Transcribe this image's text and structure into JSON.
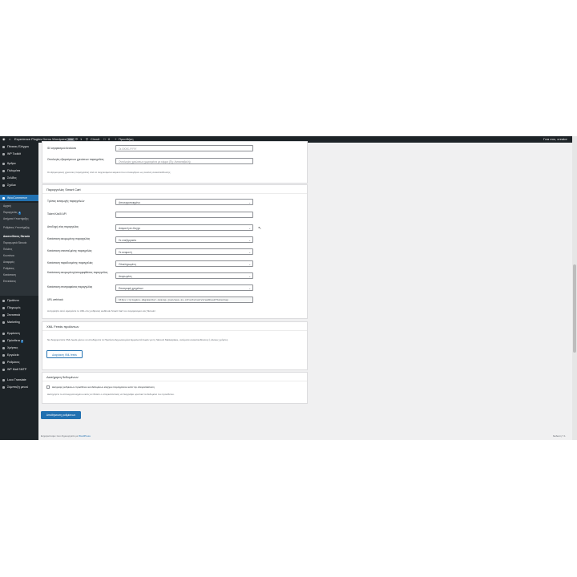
{
  "adminbar": {
    "site_name": "Experience Plugins Demo Wordpress",
    "new_badge": "new",
    "updates": "1",
    "search": "Circuit",
    "comments": "0",
    "add_new": "Προσθήκη",
    "howdy": "Γεια σου, creator"
  },
  "sidebar": {
    "items_top": [
      {
        "label": "Πίνακας Ελέγχου",
        "icon": "dashboard-icon"
      },
      {
        "label": "WP Toolkit",
        "icon": "toolkit-icon"
      },
      {
        "label": "Άρθρα",
        "icon": "pin-icon"
      },
      {
        "label": "Πολυμέσα",
        "icon": "media-icon"
      },
      {
        "label": "Σελίδες",
        "icon": "pages-icon"
      },
      {
        "label": "Σχόλια",
        "icon": "comments-icon"
      }
    ],
    "woocommerce": "WooCommerce",
    "submenu": [
      {
        "label": "Αρχική",
        "badge": ""
      },
      {
        "label": "Παραγγελίες",
        "badge": "1"
      },
      {
        "label": "Αιτήματα Υποστήριξης",
        "badge": ""
      },
      {
        "label": "Ρυθμίσεις Υποστήριξης",
        "badge": ""
      },
      {
        "label": "Διασυνδέσεις Skroutz",
        "badge": ""
      },
      {
        "label": "Παραγωγικά Skroutz",
        "badge": ""
      },
      {
        "label": "Πελάτες",
        "badge": ""
      },
      {
        "label": "Κουπόνια",
        "badge": ""
      },
      {
        "label": "Αναφορές",
        "badge": ""
      },
      {
        "label": "Ρυθμίσεις",
        "badge": ""
      },
      {
        "label": "Κατάσταση",
        "badge": ""
      },
      {
        "label": "Επεκτάσεις",
        "badge": ""
      }
    ],
    "items_bottom": [
      {
        "label": "Προϊόντα",
        "icon": "products-icon",
        "badge": ""
      },
      {
        "label": "Πληρωμές",
        "icon": "payments-icon",
        "badge": ""
      },
      {
        "label": "Στατιστικά",
        "icon": "stats-icon",
        "badge": ""
      },
      {
        "label": "Marketing",
        "icon": "marketing-icon",
        "badge": ""
      },
      {
        "label": "Εμφάνιση",
        "icon": "appearance-icon",
        "badge": ""
      },
      {
        "label": "Πρόσθετα",
        "icon": "plugins-icon",
        "badge": "3"
      },
      {
        "label": "Χρήστες",
        "icon": "users-icon",
        "badge": ""
      },
      {
        "label": "Εργαλεία",
        "icon": "tools-icon",
        "badge": ""
      },
      {
        "label": "Ρυθμίσεις",
        "icon": "settings-icon",
        "badge": ""
      },
      {
        "label": "WP Mail SMTP",
        "icon": "mail-icon",
        "badge": ""
      },
      {
        "label": "Loco Translate",
        "icon": "translate-icon",
        "badge": ""
      },
      {
        "label": "Σύμπτυξη μενού",
        "icon": "collapse-icon",
        "badge": ""
      }
    ]
  },
  "card1": {
    "rows": [
      {
        "label": "ID λογαριασμού Αναλύσει",
        "value": "Σε XXXX-YYYY",
        "placeholder": true
      },
      {
        "label": "Οντολογίες εξαιρούμενων χρεώσεων παραγγελίας",
        "value": "Οντολογίες χρεώσεων χωρισμένοι με κόμμα (Πχ: Αντικαταβολή)",
        "placeholder": true
      }
    ],
    "description": "Οι εξαιρούμενες χρεώσεις παραγγελίας από τα ανιχνευόμενα κείμενα που υπολογίζουν ως σκοπός ανακατεύθυνσης."
  },
  "card2": {
    "title": "Παραγγελίες Smart Cart",
    "rows": [
      {
        "label": "Τρόπος εισαγωγής παραγγελιών",
        "value": "Απενεργοποιημένο",
        "select": true,
        "placeholder": false
      },
      {
        "label": "Token Κλειδί API",
        "value": "",
        "select": false,
        "placeholder": false
      },
      {
        "label": "Αποδοχή νέας παραγγελίας",
        "value": "Αναμονή σε έλεγχο",
        "select": true,
        "placeholder": false
      },
      {
        "label": "Κατάσταση ακυρωμένης παραγγελίας",
        "value": "Σε επεξεργασία",
        "select": true,
        "placeholder": false
      },
      {
        "label": "Κατάσταση απεσταλμένης παραγγελίας",
        "value": "Σε αναμονή",
        "select": true,
        "placeholder": false
      },
      {
        "label": "Κατάσταση παραδοσμένης παραγγελίας",
        "value": "Ολοκληρωμένη",
        "select": true,
        "placeholder": false
      },
      {
        "label": "Κατάσταση ακυρωμένης/απορριφθείσας παραγγελίας",
        "value": "Ακυρωμένη",
        "select": true,
        "placeholder": false
      },
      {
        "label": "Κατάσταση επιστραφείσας παραγγελίας",
        "value": "Επιστροφή χρημάτων",
        "select": true,
        "placeholder": false
      },
      {
        "label": "URL webhook",
        "value": "https://plugins.digimenter.com/wp-json/wos-is-structured/v1/webhook?token=wp",
        "select": false,
        "placeholder": false
      }
    ],
    "description": "Αντιγράψτε αυτό αφαιρέστε το URL στις ρυθμίσεις webhook Smart Cart του λογαριασμού σας Skroutz."
  },
  "card3": {
    "title": "XML Feeds προϊόντων",
    "description": "Να διαχειριστείτε XML feeds μέσου να αποδέχεστε τα Προϊόντα Δημοσιευμένα Εμφανιστά feeds για τη Skroutz Marketplace, αυτόματα ανακατευθύνσεις ή άλλους χρήστες.",
    "button": "Διαχείριση XML feeds"
  },
  "card4": {
    "title": "Διατήρηση δεδομένων",
    "checkbox_label": "Διαγραφή ρυθμίσεων πρόσθετου και δεδομένων ελέγχου παραγγελιών κατά την απεγκατάσταση",
    "description": "Διατηρήστε το απενεργοποιημένο εκτός αν θέλετε ο απεγκατάσταση να διαγράψει οριστικά τα δεδομένα του πρόσθετου."
  },
  "save_button": "Αποθήκευση ρυθμίσεων",
  "footer": {
    "thanks_prefix": "Ευχαριστούμε που δημιουργείτε με ",
    "wordpress": "WordPress",
    "version": "Έκδοση 7.1"
  }
}
